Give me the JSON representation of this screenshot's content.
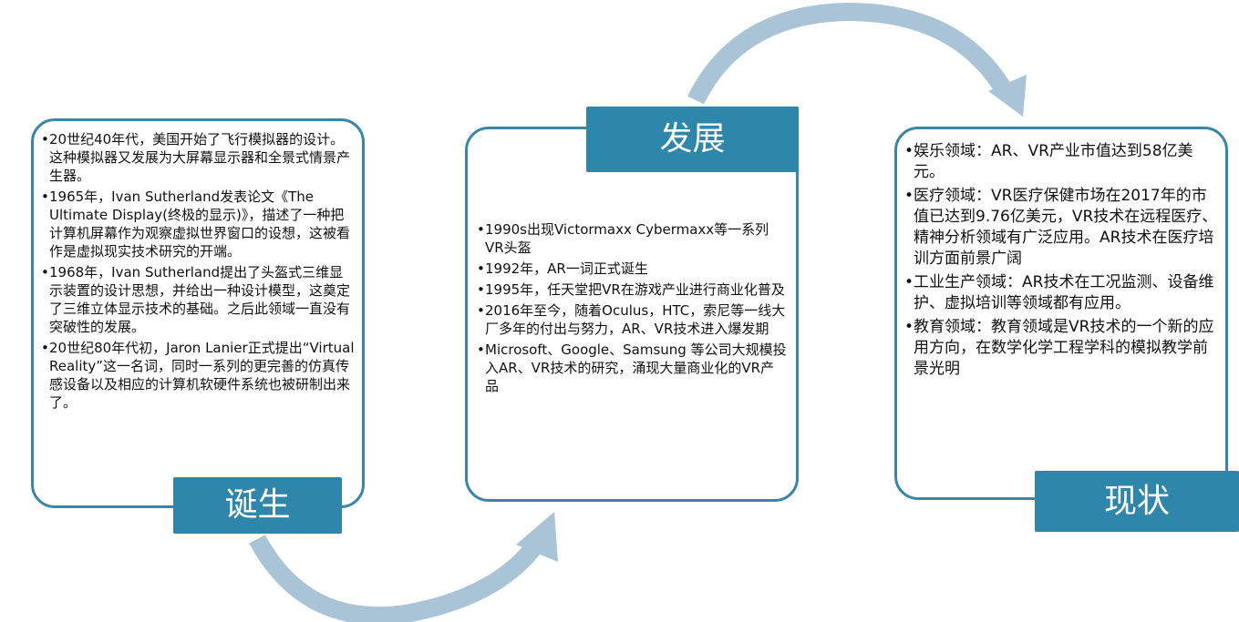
{
  "colors": {
    "accent": "#2e86ab",
    "border": "#3a86aa",
    "arrow": "#a9c4d7"
  },
  "stages": {
    "birth": {
      "label": "诞生",
      "items": [
        "20世纪40年代，美国开始了飞行模拟器的设计。这种模拟器又发展为大屏幕显示器和全景式情景产生器。",
        "1965年，Ivan Sutherland发表论文《The Ultimate Display(终极的显示)》，描述了一种把计算机屏幕作为观察虚拟世界窗口的设想，这被看作是虚拟现实技术研究的开端。",
        "1968年，Ivan Sutherland提出了头盔式三维显示装置的设计思想，并给出一种设计模型，这奠定了三维立体显示技术的基础。之后此领域一直没有突破性的发展。",
        "20世纪80年代初，Jaron Lanier正式提出“Virtual Reality”这一名词，同时一系列的更完善的仿真传感设备以及相应的计算机软硬件系统也被研制出来了。"
      ]
    },
    "development": {
      "label": "发展",
      "items": [
        "1990s出现Victormaxx Cybermaxx等一系列VR头盔",
        "1992年，AR一词正式诞生",
        "1995年，任天堂把VR在游戏产业进行商业化普及",
        "2016年至今，随着Oculus，HTC，索尼等一线大厂多年的付出与努力，AR、VR技术进入爆发期",
        "Microsoft、Google、Samsung 等公司大规模投入AR、VR技术的研究，涌现大量商业化的VR产品"
      ]
    },
    "status": {
      "label": "现状",
      "items": [
        "娱乐领域：AR、VR产业市值达到58亿美元。",
        "医疗领域：VR医疗保健市场在2017年的市值已达到9.76亿美元，VR技术在远程医疗、精神分析领域有广泛应用。AR技术在医疗培训方面前景广阔",
        "工业生产领域：AR技术在工况监测、设备维护、虚拟培训等领域都有应用。",
        "教育领域：教育领域是VR技术的一个新的应用方向，在数学化学工程学科的模拟教学前景光明"
      ]
    }
  }
}
